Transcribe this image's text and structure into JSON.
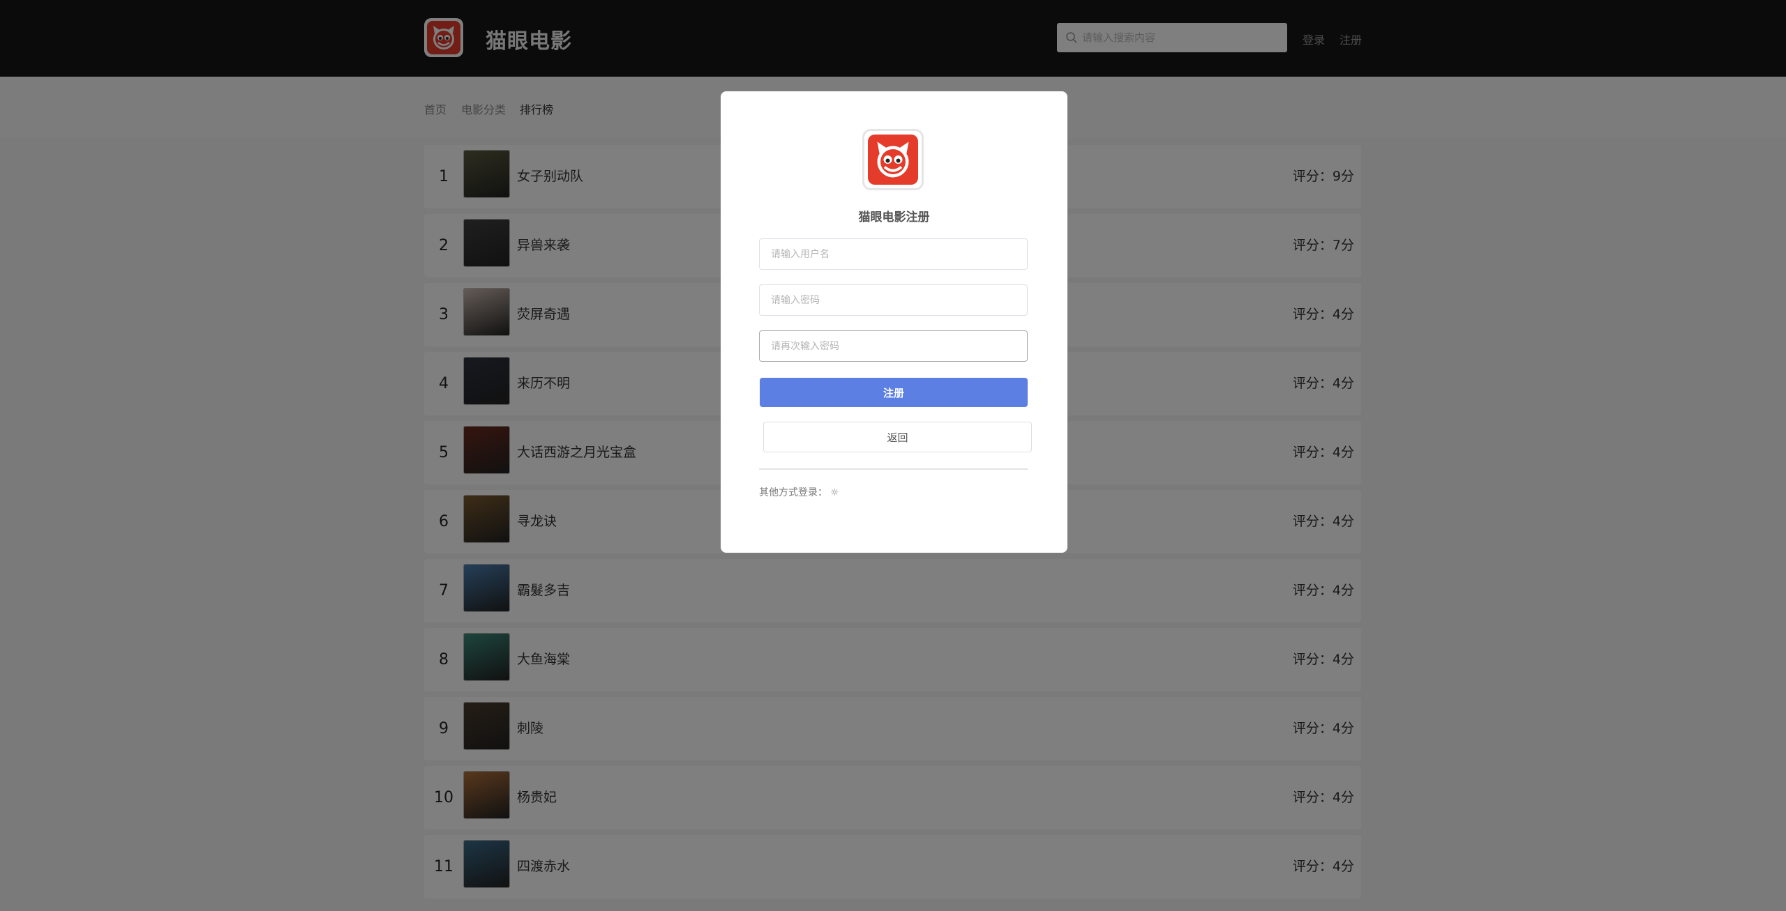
{
  "colors": {
    "header_bg": "#161616",
    "brand_red": "#e53b2a",
    "primary_button": "#5b7fe2",
    "overlay": "rgba(0,0,0,0.5)"
  },
  "header": {
    "brand": "猫眼电影",
    "search_placeholder": "请输入搜索内容",
    "login": "登录",
    "register": "注册",
    "logo_icon": "cat-logo-icon",
    "search_icon": "search-icon"
  },
  "breadcrumb": {
    "items": [
      "首页",
      "电影分类",
      "排行榜"
    ],
    "active": "排行榜"
  },
  "ranking": {
    "items": [
      {
        "rank": "1",
        "title": "女子别动队",
        "score": "评分：9分",
        "poster_color": "#5b5a3e"
      },
      {
        "rank": "2",
        "title": "异兽来袭",
        "score": "评分：7分",
        "poster_color": "#3f3f42"
      },
      {
        "rank": "3",
        "title": "荧屏奇遇",
        "score": "评分：4分",
        "poster_color": "#c9b7ad"
      },
      {
        "rank": "4",
        "title": "来历不明",
        "score": "评分：4分",
        "poster_color": "#2d3240"
      },
      {
        "rank": "5",
        "title": "大话西游之月光宝盒",
        "score": "评分：4分",
        "poster_color": "#6b2a1e"
      },
      {
        "rank": "6",
        "title": "寻龙诀",
        "score": "评分：4分",
        "poster_color": "#7a5a2e"
      },
      {
        "rank": "7",
        "title": "霸髮多吉",
        "score": "评分：4分",
        "poster_color": "#4a7fb0"
      },
      {
        "rank": "8",
        "title": "大鱼海棠",
        "score": "评分：4分",
        "poster_color": "#3b8a7a"
      },
      {
        "rank": "9",
        "title": "刺陵",
        "score": "评分：4分",
        "poster_color": "#4a3b2c"
      },
      {
        "rank": "10",
        "title": "杨贵妃",
        "score": "评分：4分",
        "poster_color": "#b0703a"
      },
      {
        "rank": "11",
        "title": "四渡赤水",
        "score": "评分：4分",
        "poster_color": "#3a6b8a"
      }
    ]
  },
  "modal": {
    "title": "猫眼电影注册",
    "username_placeholder": "请输入用户名",
    "password_placeholder": "请输入密码",
    "confirm_placeholder": "请再次输入密码",
    "submit": "注册",
    "back": "返回",
    "other_login": "其他方式登录：",
    "other_icon": "☼"
  }
}
